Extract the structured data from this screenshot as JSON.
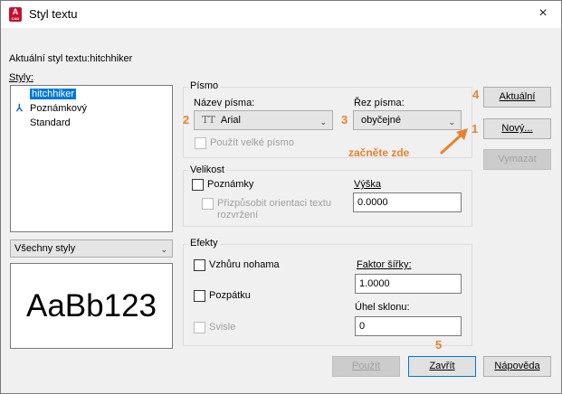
{
  "window": {
    "title": "Styl textu",
    "app_icon_letter": "A",
    "app_icon_sub": "CAD",
    "close_glyph": "×"
  },
  "current_style": "Aktuální styl textu:hitchhiker",
  "styles": {
    "label": "Styly:",
    "items": [
      {
        "label": "hitchhiker",
        "selected": true,
        "annotative": false
      },
      {
        "label": "Poznámkový",
        "selected": false,
        "annotative": true,
        "icon": "annotative-icon"
      },
      {
        "label": "Standard",
        "selected": false,
        "annotative": false
      }
    ],
    "annotative_glyph": "⅄"
  },
  "filter": {
    "value": "Všechny styly"
  },
  "preview": {
    "text": "AaBb123"
  },
  "font_group": {
    "title": "Písmo",
    "font_name_label": "Název písma:",
    "font_name_value": "Arial",
    "font_name_icon": "TT",
    "font_style_label": "Řez písma:",
    "font_style_value": "obyčejné",
    "bigfont_label": "Použít velké písmo"
  },
  "size_group": {
    "title": "Velikost",
    "annotative_label": "Poznámky",
    "orientation_label_1": "Přizpůsobit orientaci textu",
    "orientation_label_2": "rozvržení",
    "height_label": "Výška",
    "height_value": "0.0000"
  },
  "effects_group": {
    "title": "Efekty",
    "upside_down_label": "Vzhůru nohama",
    "backwards_label": "Pozpátku",
    "vertical_label": "Svisle",
    "width_factor_label": "Faktor šířky:",
    "width_factor_value": "1.0000",
    "oblique_label": "Úhel sklonu:",
    "oblique_value": "0"
  },
  "buttons": {
    "set_current": "Aktuální",
    "new": "Nový...",
    "delete": "Vymazat",
    "apply": "Použít",
    "close": "Zavřít",
    "help": "Nápověda"
  },
  "annotations": {
    "n1": "1",
    "n2": "2",
    "n3": "3",
    "n4": "4",
    "n5": "5",
    "hint": "začněte zde",
    "color": "#e8822e"
  },
  "colors": {
    "selection": "#0078d7",
    "app_icon": "#c8102e",
    "annotative_icon": "#1e64c8"
  }
}
